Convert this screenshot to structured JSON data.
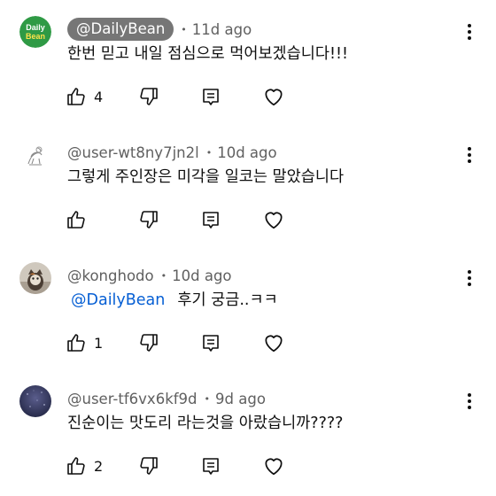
{
  "comments": [
    {
      "author": "@DailyBean",
      "author_is_creator": true,
      "avatar_text": [
        "Daily",
        "Bean"
      ],
      "time": "11d ago",
      "text": "한번 믿고 내일 점심으로 먹어보겠습니다!!!",
      "likes": "4"
    },
    {
      "author": "@user-wt8ny7jn2l",
      "time": "10d ago",
      "text": "그렇게 주인장은 미각을 일코는 말았습니다",
      "likes": ""
    },
    {
      "author": "@konghodo",
      "time": "10d ago",
      "mention": "@DailyBean",
      "text": "후기 궁금..ㅋㅋ",
      "likes": "1"
    },
    {
      "author": "@user-tf6vx6kf9d",
      "time": "9d ago",
      "text": "진순이는 맛도리 라는것을 아랐습니까????",
      "likes": "2"
    }
  ],
  "separator": "•",
  "icons": {
    "like": "thumbs-up-icon",
    "dislike": "thumbs-down-icon",
    "reply": "reply-comment-icon",
    "heart": "heart-icon",
    "more": "more-vertical-icon"
  },
  "colors": {
    "creator_chip": "#767676",
    "mention": "#065fd4",
    "meta_text": "#606060",
    "avatar_daily_bean": "#2f9a45"
  }
}
